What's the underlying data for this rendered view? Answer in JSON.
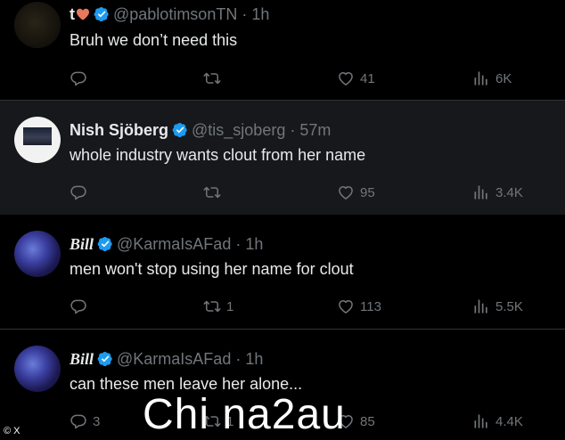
{
  "tweets": [
    {
      "name": "t",
      "name_emoji": "heart",
      "handle": "@pablotimsonTN",
      "time": "· 1h",
      "text": "Bruh we don’t need this",
      "replies": "",
      "retweets": "",
      "likes": "41",
      "views": "6K"
    },
    {
      "name": "Nish Sjöberg",
      "handle": "@tis_sjoberg",
      "time": "· 57m",
      "text": "whole industry wants clout from her name",
      "replies": "",
      "retweets": "",
      "likes": "95",
      "views": "3.4K"
    },
    {
      "name": "Bill",
      "handle": "@KarmaIsAFad",
      "time": "· 1h",
      "text": "men won't stop using her name for clout",
      "replies": "",
      "retweets": "1",
      "likes": "113",
      "views": "5.5K"
    },
    {
      "name": "Bill",
      "handle": "@KarmaIsAFad",
      "time": "· 1h",
      "text": "can these men leave her alone...",
      "replies": "3",
      "retweets": "1",
      "likes": "85",
      "views": "4.4K"
    }
  ],
  "watermark": "Chi na2au",
  "credit": "© X",
  "colors": {
    "background": "#000000",
    "text": "#e7e9ea",
    "muted": "#71767b",
    "verified": "#1d9bf0",
    "heart": "#e8795a"
  }
}
